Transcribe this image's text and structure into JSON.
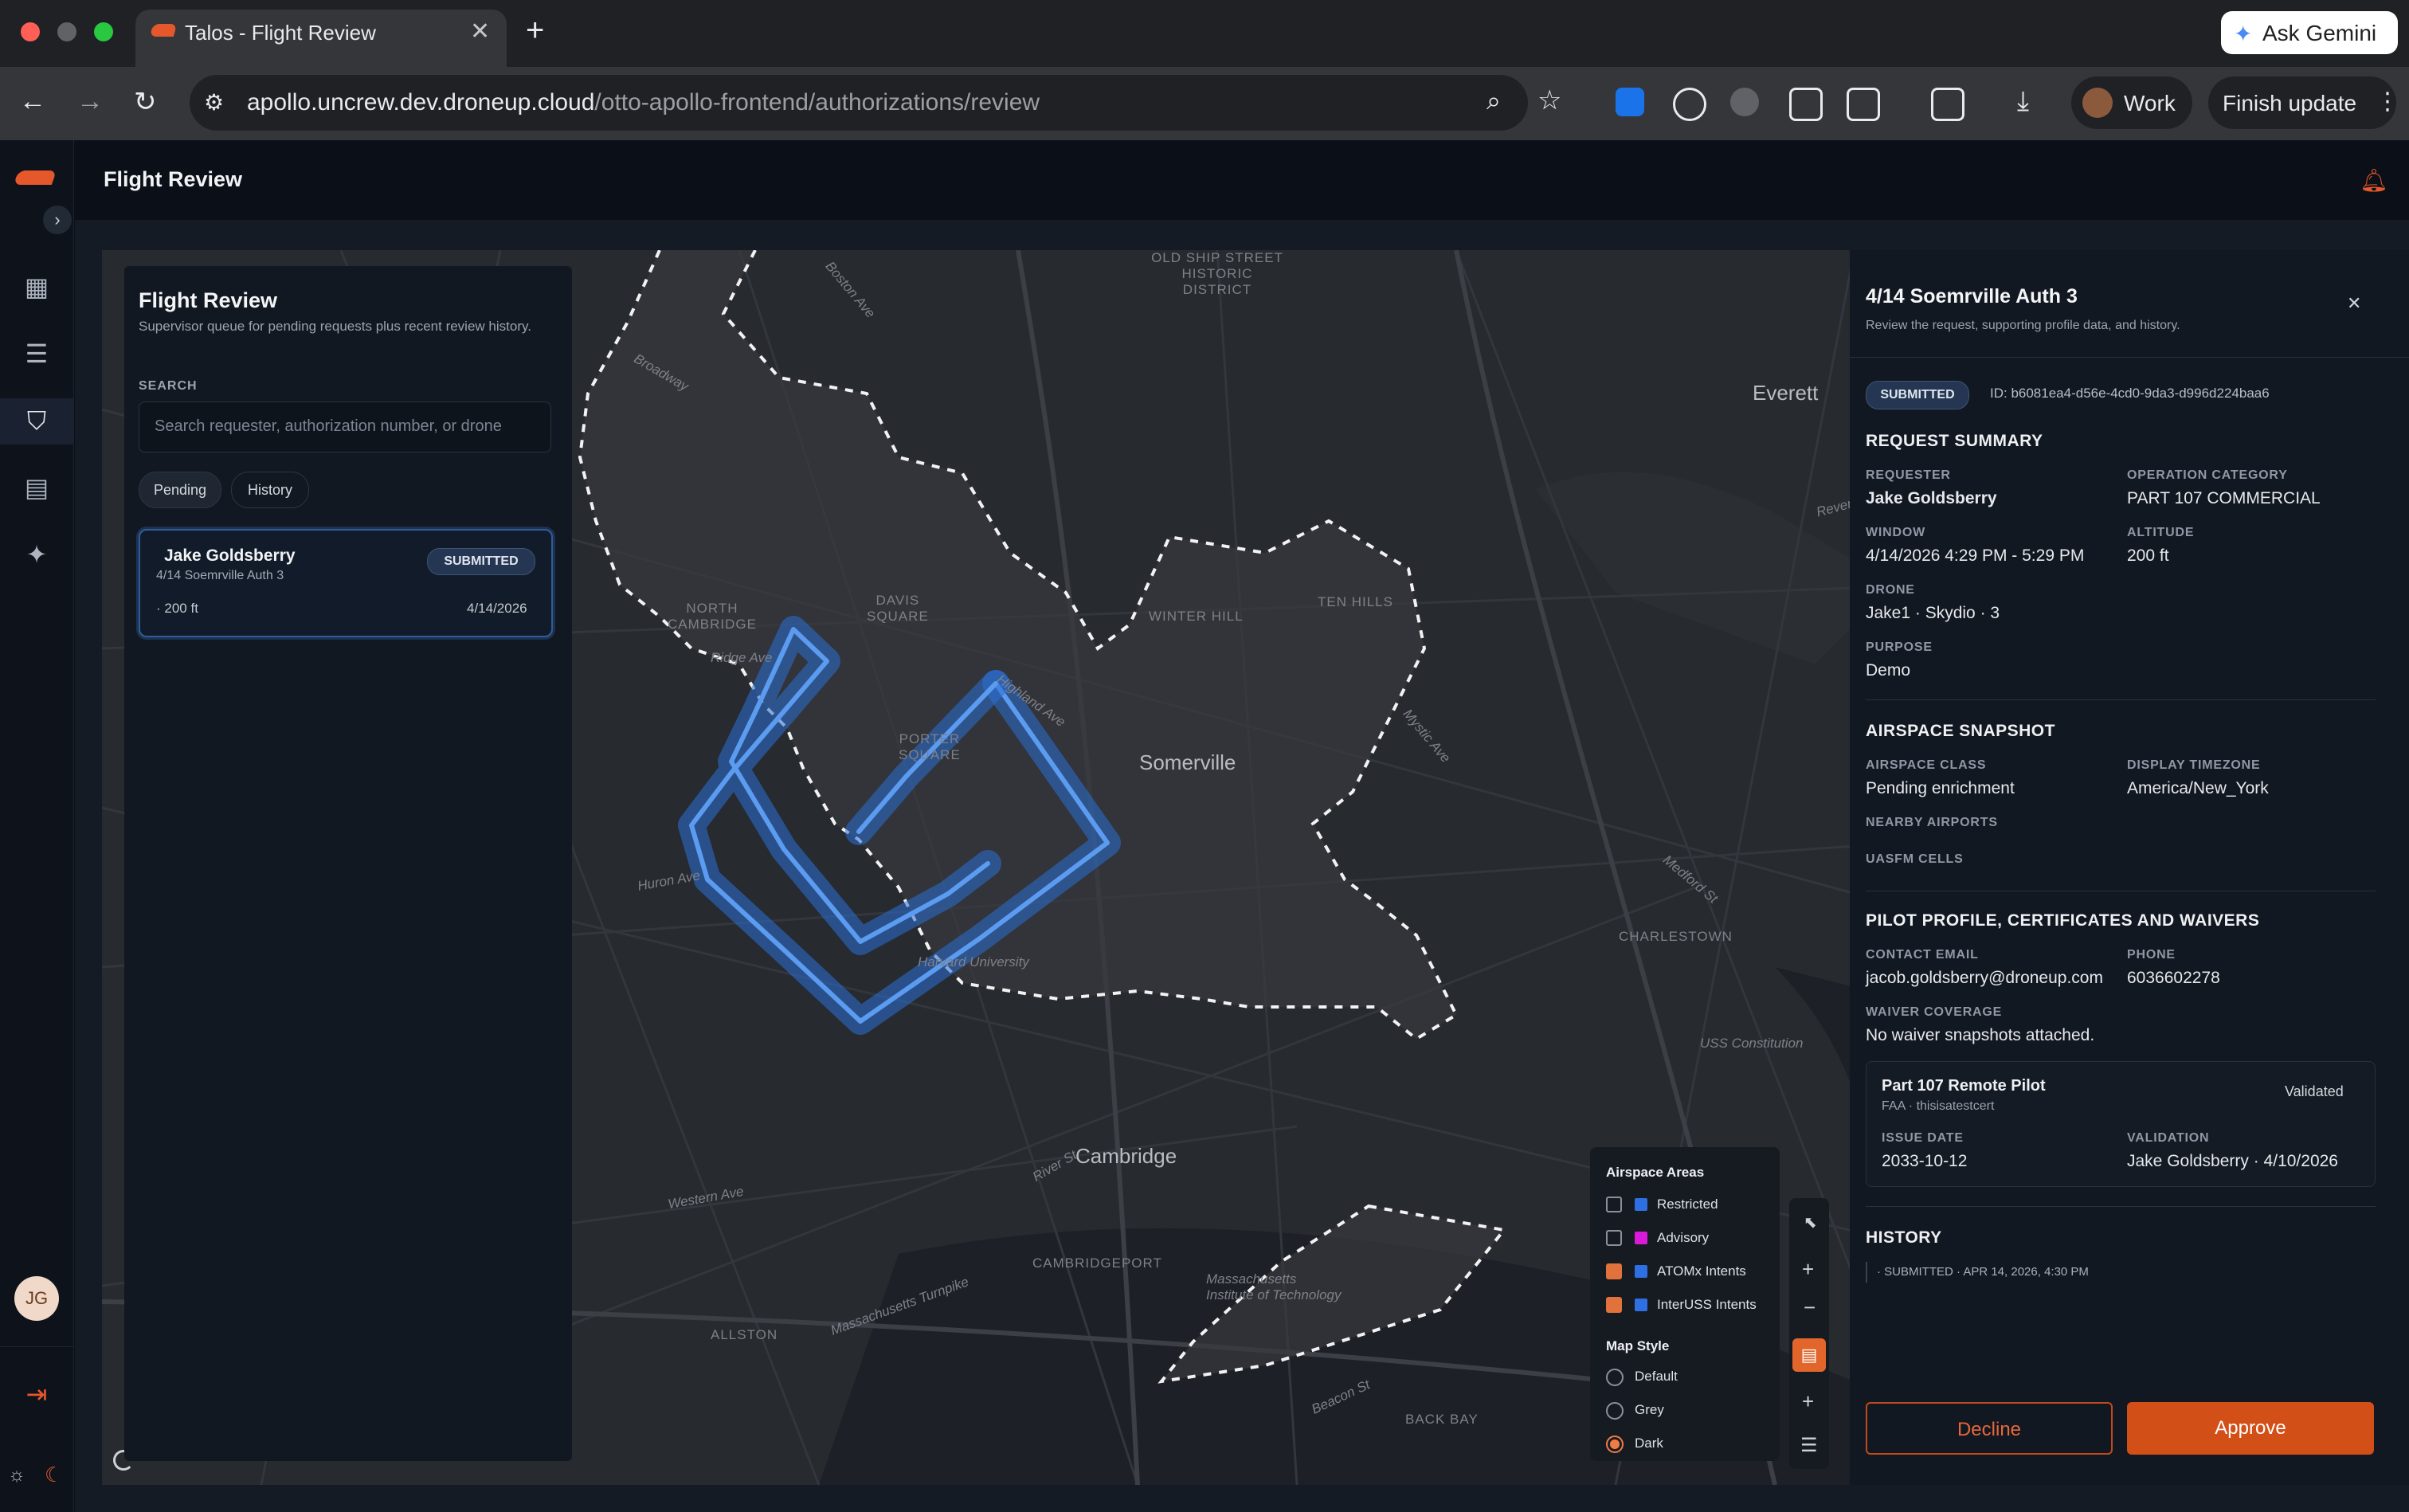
{
  "browser": {
    "tab_title": "Talos - Flight Review",
    "url_host": "apollo.uncrew.dev.droneup.cloud",
    "url_path": "/otto-apollo-frontend/authorizations/review",
    "gemini_label": "Ask Gemini",
    "profile_label": "Work",
    "update_label": "Finish update"
  },
  "app": {
    "page_title": "Flight Review",
    "avatar_initials": "JG"
  },
  "left_panel": {
    "title": "Flight Review",
    "subtitle": "Supervisor queue for pending requests plus recent review history.",
    "search_label": "SEARCH",
    "search_placeholder": "Search requester, authorization number, or drone",
    "tabs": [
      "Pending",
      "History"
    ],
    "requests": [
      {
        "requester": "Jake Goldsberry",
        "name": "4/14 Soemrville Auth 3",
        "altitude": "· 200 ft",
        "date": "4/14/2026",
        "status": "SUBMITTED"
      }
    ]
  },
  "map": {
    "labels": {
      "somerville": "Somerville",
      "cambridge": "Cambridge",
      "everett": "Everett",
      "north_cambridge": "NORTH\nCAMBRIDGE",
      "davis_square": "DAVIS\nSQUARE",
      "porter_square": "PORTER\nSQUARE",
      "winter_hill": "WINTER HILL",
      "ten_hills": "TEN HILLS",
      "charlestown": "CHARLESTOWN",
      "cambridgeport": "CAMBRIDGEPORT",
      "allston": "ALLSTON",
      "back_bay": "BACK BAY",
      "harvard": "Harvard University",
      "mit": "Massachusetts\nInstitute of Technology",
      "old_ship": "OLD SHIP STREET\nHISTORIC\nDISTRICT",
      "broadway": "Broadway",
      "huron_ave": "Huron Ave",
      "western_ave": "Western Ave",
      "mystic_ave": "Mystic Ave",
      "medford_st": "Medford St",
      "ridge_ave": "Ridge Ave",
      "highland_ave": "Highland Ave",
      "uss_constitution": "USS Constitution",
      "revere_beach": "Revere Beach Pkwy",
      "boston_ave": "Boston Ave",
      "river_st": "River St",
      "beacon_st": "Beacon St",
      "mass_tpke": "Massachusetts Turnpike"
    },
    "legend": {
      "areas_title": "Airspace Areas",
      "areas": [
        {
          "label": "Restricted",
          "checked": false,
          "color": "#2f6fe4"
        },
        {
          "label": "Advisory",
          "checked": false,
          "color": "#d91ad9"
        },
        {
          "label": "ATOMx Intents",
          "checked": true,
          "color": "#2f6fe4"
        },
        {
          "label": "InterUSS Intents",
          "checked": true,
          "color": "#2f6fe4"
        }
      ],
      "style_title": "Map Style",
      "styles": [
        {
          "label": "Default",
          "selected": false
        },
        {
          "label": "Grey",
          "selected": false
        },
        {
          "label": "Dark",
          "selected": true
        }
      ]
    }
  },
  "detail": {
    "title": "4/14 Soemrville Auth 3",
    "subtitle": "Review the request, supporting profile data, and history.",
    "status": "SUBMITTED",
    "id": "ID: b6081ea4-d56e-4cd0-9da3-d996d224baa6",
    "request_summary": {
      "heading": "REQUEST SUMMARY",
      "requester_label": "REQUESTER",
      "requester": "Jake Goldsberry",
      "category_label": "OPERATION CATEGORY",
      "category": "PART 107 COMMERCIAL",
      "window_label": "WINDOW",
      "window": "4/14/2026 4:29 PM - 5:29 PM",
      "altitude_label": "ALTITUDE",
      "altitude": "200 ft",
      "drone_label": "DRONE",
      "drone": "Jake1 · Skydio · 3",
      "purpose_label": "PURPOSE",
      "purpose": "Demo"
    },
    "airspace": {
      "heading": "AIRSPACE SNAPSHOT",
      "class_label": "AIRSPACE CLASS",
      "class": "Pending enrichment",
      "tz_label": "DISPLAY TIMEZONE",
      "tz": "America/New_York",
      "airports_label": "NEARBY AIRPORTS",
      "cells_label": "UASFM CELLS"
    },
    "pilot": {
      "heading": "PILOT PROFILE, CERTIFICATES AND WAIVERS",
      "email_label": "CONTACT EMAIL",
      "email": "jacob.goldsberry@droneup.com",
      "phone_label": "PHONE",
      "phone": "6036602278",
      "waiver_label": "WAIVER COVERAGE",
      "waiver": "No waiver snapshots attached.",
      "cert_title": "Part 107 Remote Pilot",
      "cert_sub": "FAA · thisisatestcert",
      "cert_status": "Validated",
      "issue_label": "ISSUE DATE",
      "issue": "2033-10-12",
      "validation_label": "VALIDATION",
      "validation": "Jake Goldsberry · 4/10/2026"
    },
    "history": {
      "heading": "HISTORY",
      "entry": "· SUBMITTED · APR 14, 2026, 4:30 PM"
    },
    "decline_label": "Decline",
    "approve_label": "Approve"
  }
}
